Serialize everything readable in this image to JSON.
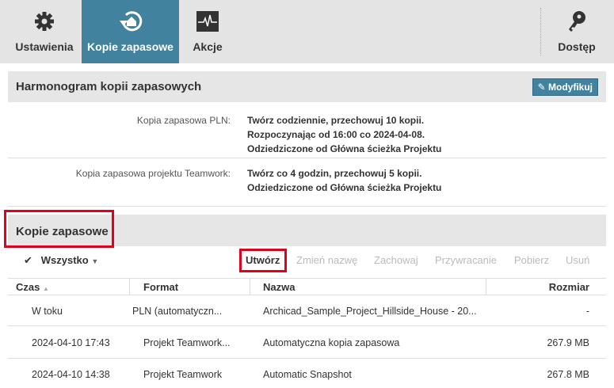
{
  "nav": {
    "tabs": [
      {
        "label": "Ustawienia",
        "icon": "gear-icon"
      },
      {
        "label": "Kopie zapasowe",
        "icon": "backup-icon"
      },
      {
        "label": "Akcje",
        "icon": "activity-icon"
      }
    ],
    "access": {
      "label": "Dostęp",
      "icon": "key-icon"
    }
  },
  "schedule": {
    "title": "Harmonogram kopii zapasowych",
    "modify": "Modyfikuj",
    "rows": [
      {
        "key": "Kopia zapasowa PLN:",
        "lines": [
          "Twórz codziennie, przechowuj 10 kopii.",
          "Rozpoczynając od 16:00 co 2024-04-08.",
          "Odziedziczone od Główna ścieżka Projektu"
        ]
      },
      {
        "key": "Kopia zapasowa projektu Teamwork:",
        "lines": [
          "Twórz co 4 godzin, przechowuj 5 kopii.",
          "Odziedziczone od Główna ścieżka Projektu"
        ]
      }
    ]
  },
  "backups": {
    "title": "Kopie zapasowe",
    "filter": "Wszystko",
    "actions": {
      "create": "Utwórz",
      "rename": "Zmień nazwę",
      "keep": "Zachowaj",
      "restore": "Przywracanie",
      "download": "Pobierz",
      "delete": "Usuń"
    },
    "columns": [
      "Czas",
      "Format",
      "Nazwa",
      "Rozmiar"
    ],
    "rows": [
      [
        "W toku",
        "PLN (automatyczn...",
        "Archicad_Sample_Project_Hillside_House - 20...",
        "-"
      ],
      [
        "2024-04-10 17:43",
        "Projekt Teamwork...",
        "Automatyczna kopia zapasowa",
        "267.9 MB"
      ],
      [
        "2024-04-10 14:38",
        "Projekt Teamwork",
        "Automatic Snapshot",
        "267.8 MB"
      ]
    ]
  },
  "colors": {
    "accent": "#41839e",
    "highlight": "#e0001b"
  }
}
